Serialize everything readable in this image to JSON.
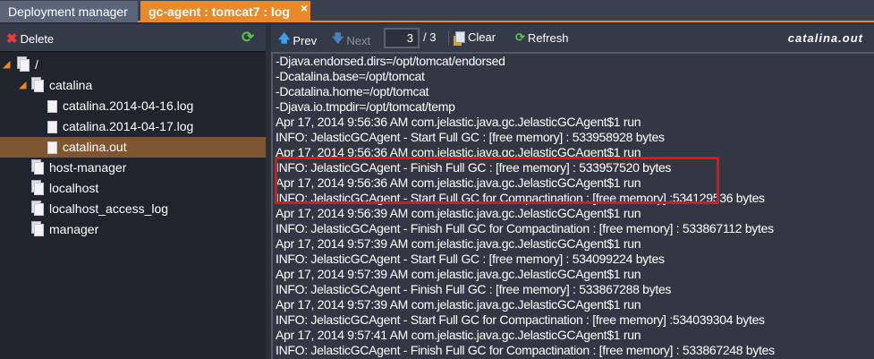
{
  "tabs": [
    {
      "label": "Deployment manager"
    },
    {
      "label": "gc-agent : tomcat7 : log",
      "close": "×"
    }
  ],
  "left": {
    "delete_label": "Delete",
    "tree": [
      {
        "label": "/",
        "type": "folder",
        "state": "open"
      },
      {
        "label": "catalina",
        "type": "folder",
        "state": "open"
      },
      {
        "label": "catalina.2014-04-16.log",
        "type": "file"
      },
      {
        "label": "catalina.2014-04-17.log",
        "type": "file"
      },
      {
        "label": "catalina.out",
        "type": "file",
        "selected": true
      },
      {
        "label": "host-manager",
        "type": "folder",
        "state": "closed"
      },
      {
        "label": "localhost",
        "type": "folder",
        "state": "closed"
      },
      {
        "label": "localhost_access_log",
        "type": "folder",
        "state": "closed"
      },
      {
        "label": "manager",
        "type": "folder",
        "state": "closed"
      }
    ]
  },
  "toolbar": {
    "prev": "Prev",
    "next": "Next",
    "page": "3",
    "total": "/ 3",
    "clear": "Clear",
    "refresh": "Refresh",
    "filename": "catalina.out"
  },
  "log": [
    "-Djava.endorsed.dirs=/opt/tomcat/endorsed",
    "-Dcatalina.base=/opt/tomcat",
    "-Dcatalina.home=/opt/tomcat",
    "-Djava.io.tmpdir=/opt/tomcat/temp",
    "Apr 17, 2014 9:56:36 AM com.jelastic.java.gc.JelasticGCAgent$1 run",
    "INFO: JelasticGCAgent - Start Full GC : [free memory] : 533958928 bytes",
    "Apr 17, 2014 9:56:36 AM com.jelastic.java.gc.JelasticGCAgent$1 run",
    "INFO: JelasticGCAgent - Finish Full GC : [free memory] : 533957520 bytes",
    "Apr 17, 2014 9:56:36 AM com.jelastic.java.gc.JelasticGCAgent$1 run",
    "INFO: JelasticGCAgent - Start Full GC for Compactination : [free memory] :534129536 bytes",
    "Apr 17, 2014 9:56:39 AM com.jelastic.java.gc.JelasticGCAgent$1 run",
    "INFO: JelasticGCAgent - Finish Full GC for Compactination : [free memory] : 533867112 bytes",
    "Apr 17, 2014 9:57:39 AM com.jelastic.java.gc.JelasticGCAgent$1 run",
    "INFO: JelasticGCAgent - Start Full GC : [free memory] : 534099224 bytes",
    "Apr 17, 2014 9:57:39 AM com.jelastic.java.gc.JelasticGCAgent$1 run",
    "INFO: JelasticGCAgent - Finish Full GC : [free memory] : 533867288 bytes",
    "Apr 17, 2014 9:57:39 AM com.jelastic.java.gc.JelasticGCAgent$1 run",
    "INFO: JelasticGCAgent - Start Full GC for Compactination : [free memory] :534039304 bytes",
    "Apr 17, 2014 9:57:41 AM com.jelastic.java.gc.JelasticGCAgent$1 run",
    "INFO: JelasticGCAgent - Finish Full GC for Compactination : [free memory] : 533867248 bytes"
  ],
  "colors": {
    "accent": "#e8892a",
    "selected": "#7f5632",
    "highlight": "#e5121b"
  }
}
